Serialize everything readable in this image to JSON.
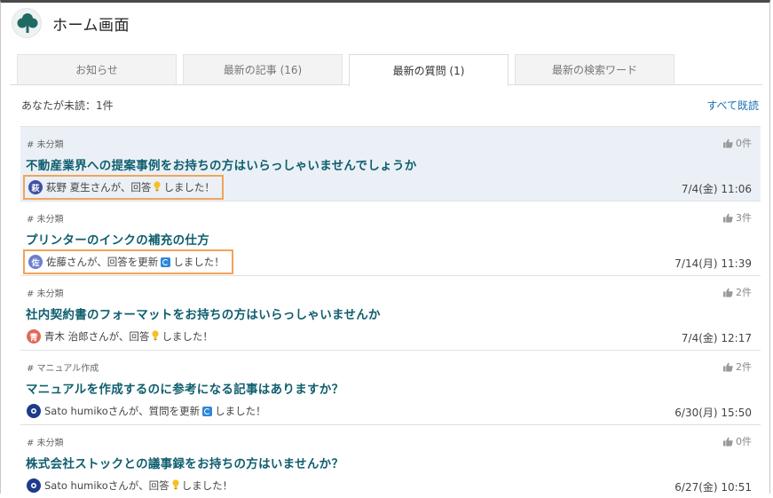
{
  "header": {
    "title": "ホーム画面"
  },
  "tabs": [
    {
      "label": "お知らせ",
      "active": false
    },
    {
      "label": "最新の記事 (16)",
      "active": false
    },
    {
      "label": "最新の質問 (1)",
      "active": true
    },
    {
      "label": "最新の検索ワード",
      "active": false
    }
  ],
  "summary": {
    "unread_text": "あなたが未読：1件",
    "mark_all_read": "すべて既読"
  },
  "items": [
    {
      "category": "# 未分類",
      "likes": "0件",
      "title": "不動産業界への提案事例をお持ちの方はいらっしゃいませんでしょうか",
      "avatar_char": "萩",
      "avatar_color": "#3f4fa3",
      "actor": "萩野 夏生さんが、回答",
      "action_suffix": "しました！",
      "icon": "bulb",
      "date": "7/4(金) 11:06",
      "unread": true,
      "highlight": true
    },
    {
      "category": "# 未分類",
      "likes": "3件",
      "title": "プリンターのインクの補充の仕方",
      "avatar_char": "佐",
      "avatar_color": "#6b7fd1",
      "actor": "佐藤さんが、回答を更新",
      "action_suffix": "しました！",
      "icon": "update",
      "date": "7/14(月) 11:39",
      "unread": false,
      "highlight": true
    },
    {
      "category": "# 未分類",
      "likes": "2件",
      "title": "社内契約書のフォーマットをお持ちの方はいらっしゃいませんか",
      "avatar_char": "青",
      "avatar_color": "#e06a5a",
      "actor": "青木 治郎さんが、回答",
      "action_suffix": "しました！",
      "icon": "bulb",
      "date": "7/4(金) 12:17",
      "unread": false,
      "highlight": false
    },
    {
      "category": "# マニュアル作成",
      "likes": "2件",
      "title": "マニュアルを作成するのに参考になる記事はありますか？",
      "avatar_char": "",
      "avatar_color": "#1d3b8a",
      "actor": "Sato humikoさんが、質問を更新",
      "action_suffix": "しました！",
      "icon": "update",
      "date": "6/30(月) 15:50",
      "unread": false,
      "highlight": false
    },
    {
      "category": "# 未分類",
      "likes": "0件",
      "title": "株式会社ストックとの議事録をお持ちの方はいませんか？",
      "avatar_char": "",
      "avatar_color": "#1d3b8a",
      "actor": "Sato humikoさんが、回答",
      "action_suffix": "しました！",
      "icon": "bulb",
      "date": "6/27(金) 10:51",
      "unread": false,
      "highlight": false
    }
  ],
  "colors": {
    "accent_link": "#1a6fb5",
    "title_text": "#0f5e6e",
    "highlight_border": "#f2a35a",
    "unread_bg": "#eaf0f6"
  }
}
